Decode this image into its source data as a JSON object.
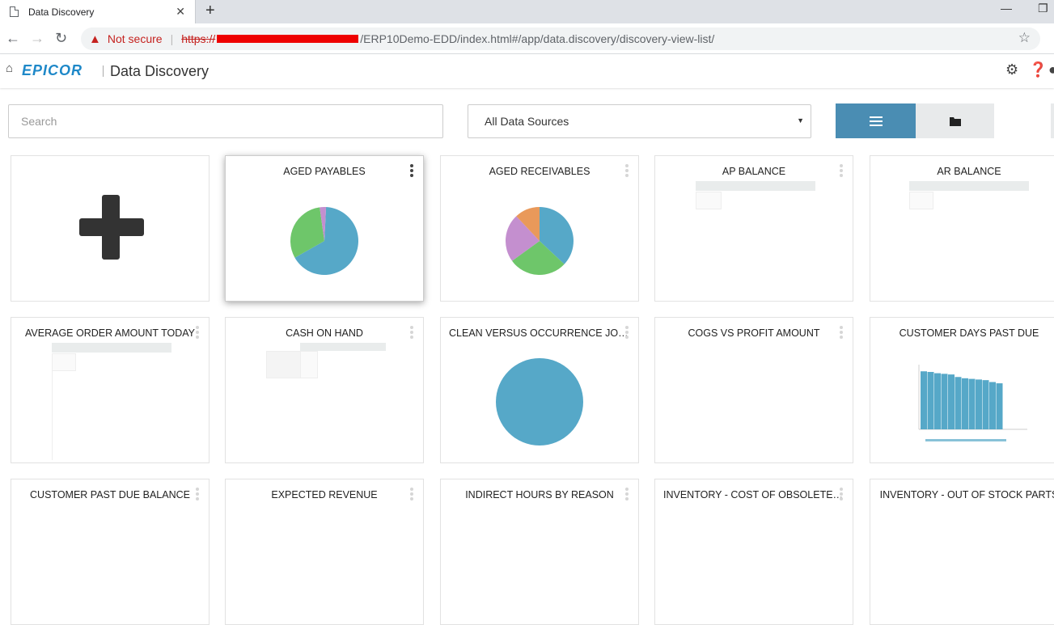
{
  "browser": {
    "tab_title": "Data Discovery",
    "new_tab": "+",
    "minimize": "—",
    "restore": "❐",
    "security_label": "Not secure",
    "url_scheme": "https://",
    "url_path": "/ERP10Demo-EDD/index.html#/app/data.discovery/discovery-view-list/"
  },
  "app": {
    "logo_text": "EPICOR",
    "title": "Data Discovery"
  },
  "toolbar": {
    "search_placeholder": "Search",
    "data_source": "All Data Sources"
  },
  "cards": [
    {
      "title": ""
    },
    {
      "title": "AGED PAYABLES"
    },
    {
      "title": "AGED RECEIVABLES"
    },
    {
      "title": "AP BALANCE"
    },
    {
      "title": "AR BALANCE"
    },
    {
      "title": "AVERAGE ORDER AMOUNT TODAY"
    },
    {
      "title": "CASH ON HAND"
    },
    {
      "title": "CLEAN VERSUS OCCURRENCE JOBS"
    },
    {
      "title": "COGS VS PROFIT AMOUNT"
    },
    {
      "title": "CUSTOMER DAYS PAST DUE"
    },
    {
      "title": "CUSTOMER PAST DUE BALANCE"
    },
    {
      "title": "EXPECTED REVENUE"
    },
    {
      "title": "INDIRECT HOURS BY REASON"
    },
    {
      "title": "INVENTORY - COST OF OBSOLETE L..."
    },
    {
      "title": "INVENTORY - OUT OF STOCK PARTS"
    }
  ],
  "colors": {
    "accent": "#4a8db3",
    "pie_blue": "#56a8c8",
    "pie_green": "#6ec66a",
    "pie_purple": "#c48fcf",
    "pie_orange": "#e9995a"
  },
  "chart_data": [
    {
      "type": "pie",
      "values": [
        66,
        31,
        3
      ]
    },
    {
      "type": "pie",
      "values": [
        37,
        28,
        23,
        12
      ]
    },
    {
      "type": "pie",
      "values": [
        100
      ]
    },
    {
      "type": "bar",
      "values": [
        92,
        91,
        89,
        88,
        87,
        83,
        81,
        80,
        79,
        78,
        75,
        73,
        0
      ]
    }
  ]
}
